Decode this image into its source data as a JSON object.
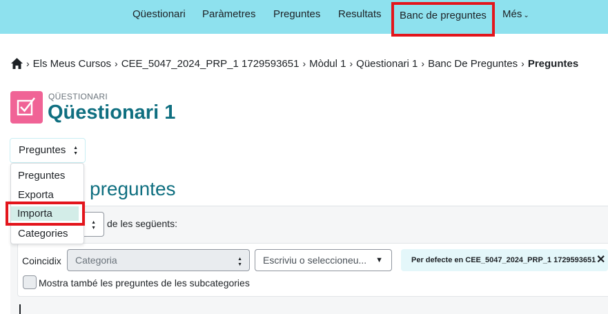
{
  "topnav": {
    "items": [
      "Qüestionari",
      "Paràmetres",
      "Preguntes",
      "Resultats",
      "Banc de preguntes",
      "Més"
    ],
    "accent": "#8ee1ee",
    "highlight_color": "#e3151c"
  },
  "breadcrumb": {
    "home_icon": "home-icon",
    "items": [
      "Els Meus Cursos",
      "CEE_5047_2024_PRP_1 1729593651",
      "Mòdul 1",
      "Qüestionari 1",
      "Banc De Preguntes"
    ],
    "current": "Preguntes"
  },
  "header": {
    "subtitle": "QÜESTIONARI",
    "title": "Qüestionari 1",
    "icon": "quiz-icon",
    "icon_color": "#f06396"
  },
  "select": {
    "value": "Preguntes"
  },
  "dropdown": {
    "items": [
      "Preguntes",
      "Exporta",
      "Importa",
      "Categories"
    ],
    "highlighted": "Importa"
  },
  "section": {
    "heading": "preguntes"
  },
  "filter": {
    "match_text": "de les següents:",
    "label": "Coincidix",
    "category_placeholder": "Categoria",
    "search_placeholder": "Escriviu o seleccioneu...",
    "tag": "Per defecte en CEE_5047_2024_PRP_1 1729593651",
    "checkbox_label": "Mostra també les preguntes de les subcategories"
  }
}
